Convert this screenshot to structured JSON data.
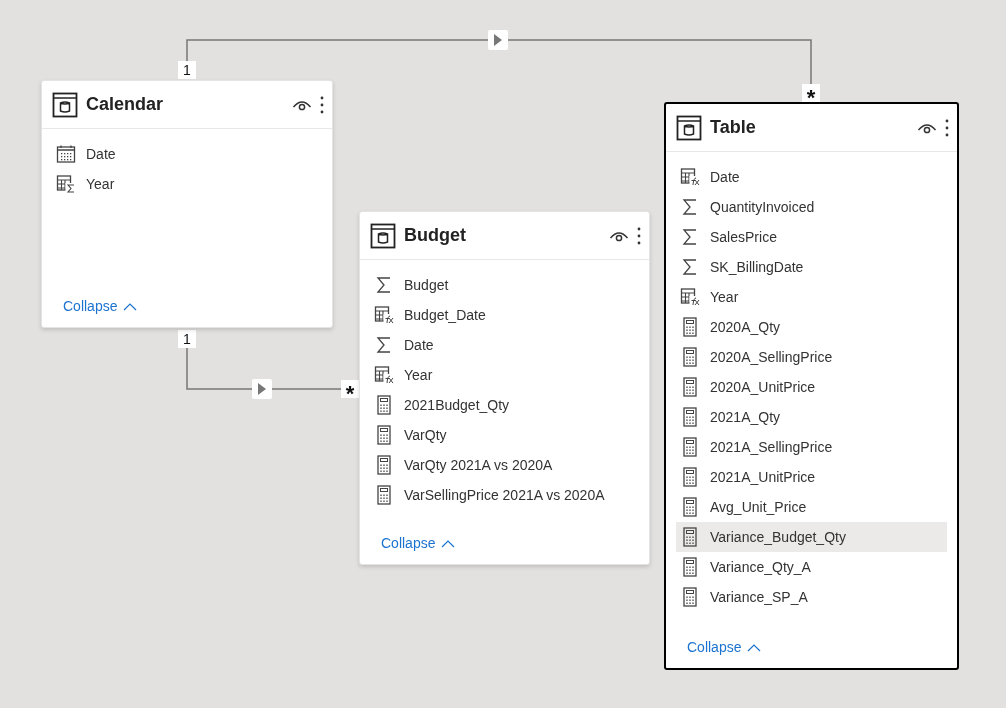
{
  "tables": [
    {
      "name": "Calendar",
      "selected": false,
      "collapse": "Collapse",
      "fields": [
        {
          "name": "Date",
          "kind": "date",
          "selected": false
        },
        {
          "name": "Year",
          "kind": "calc_sum",
          "selected": false
        }
      ]
    },
    {
      "name": "Budget",
      "selected": false,
      "collapse": "Collapse",
      "fields": [
        {
          "name": "Budget",
          "kind": "sum",
          "selected": false
        },
        {
          "name": "Budget_Date",
          "kind": "calc",
          "selected": false
        },
        {
          "name": "Date",
          "kind": "sum",
          "selected": false
        },
        {
          "name": "Year",
          "kind": "calc",
          "selected": false
        },
        {
          "name": "2021Budget_Qty",
          "kind": "measure",
          "selected": false
        },
        {
          "name": "VarQty",
          "kind": "measure",
          "selected": false
        },
        {
          "name": "VarQty 2021A vs 2020A",
          "kind": "measure",
          "selected": false
        },
        {
          "name": "VarSellingPrice 2021A vs 2020A",
          "kind": "measure",
          "selected": false
        }
      ]
    },
    {
      "name": "Table",
      "selected": true,
      "collapse": "Collapse",
      "fields": [
        {
          "name": "Date",
          "kind": "calc",
          "selected": false
        },
        {
          "name": "QuantityInvoiced",
          "kind": "sum",
          "selected": false
        },
        {
          "name": "SalesPrice",
          "kind": "sum",
          "selected": false
        },
        {
          "name": "SK_BillingDate",
          "kind": "sum",
          "selected": false
        },
        {
          "name": "Year",
          "kind": "calc",
          "selected": false
        },
        {
          "name": "2020A_Qty",
          "kind": "measure",
          "selected": false
        },
        {
          "name": "2020A_SellingPrice",
          "kind": "measure",
          "selected": false
        },
        {
          "name": "2020A_UnitPrice",
          "kind": "measure",
          "selected": false
        },
        {
          "name": "2021A_Qty",
          "kind": "measure",
          "selected": false
        },
        {
          "name": "2021A_SellingPrice",
          "kind": "measure",
          "selected": false
        },
        {
          "name": "2021A_UnitPrice",
          "kind": "measure",
          "selected": false
        },
        {
          "name": "Avg_Unit_Price",
          "kind": "measure",
          "selected": false
        },
        {
          "name": "Variance_Budget_Qty",
          "kind": "measure",
          "selected": true
        },
        {
          "name": "Variance_Qty_A",
          "kind": "measure",
          "selected": false
        },
        {
          "name": "Variance_SP_A",
          "kind": "measure",
          "selected": false
        }
      ]
    }
  ],
  "relationships": [
    {
      "from_label": "1",
      "to_label": "*"
    },
    {
      "from_label": "1",
      "to_label": "*"
    }
  ]
}
